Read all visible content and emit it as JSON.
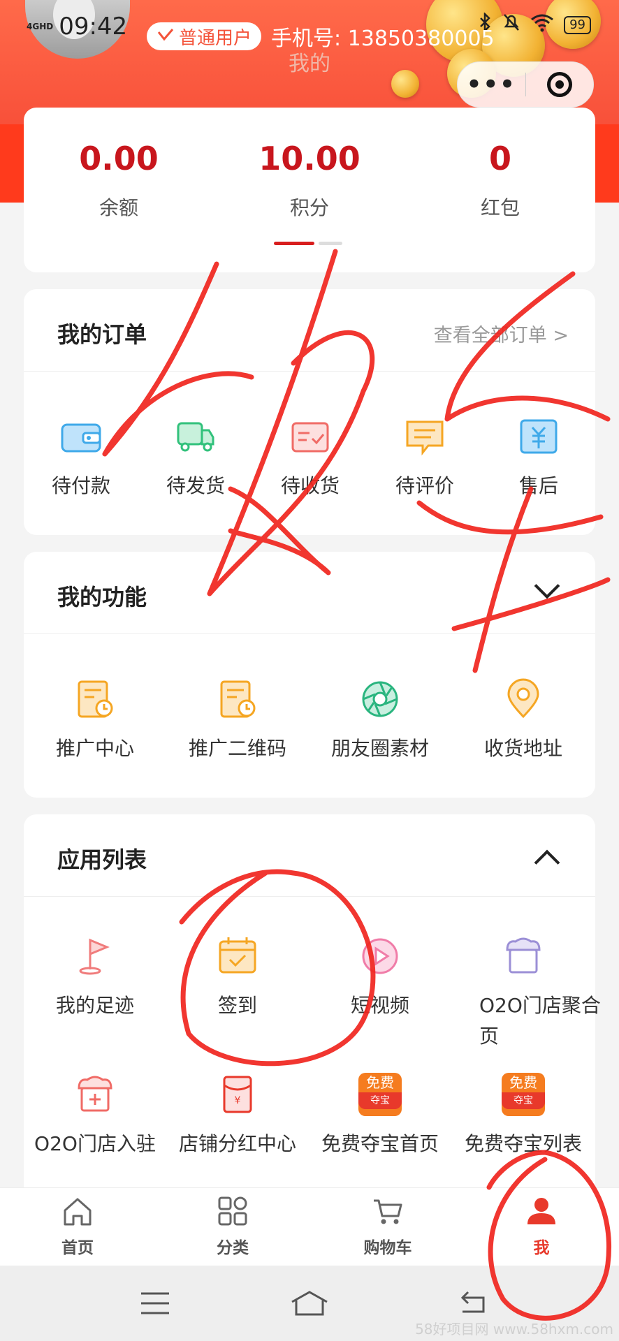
{
  "status_bar": {
    "network": "4GHD",
    "time": "09:42",
    "battery": "99"
  },
  "header": {
    "badge": "普通用户",
    "phone": "手机号: 13850380005",
    "page_title": "我的",
    "capsule_more": "•••"
  },
  "stats": [
    {
      "value": "0.00",
      "label": "余额"
    },
    {
      "value": "10.00",
      "label": "积分"
    },
    {
      "value": "0",
      "label": "红包"
    }
  ],
  "orders": {
    "title": "我的订单",
    "view_all": "查看全部订单 >",
    "items": [
      {
        "label": "待付款",
        "icon": "wallet-icon",
        "color": "#3fa9e9"
      },
      {
        "label": "待发货",
        "icon": "truck-icon",
        "color": "#31c17b"
      },
      {
        "label": "待收货",
        "icon": "receipt-icon",
        "color": "#f06b66"
      },
      {
        "label": "待评价",
        "icon": "comment-icon",
        "color": "#f5a623"
      },
      {
        "label": "售后",
        "icon": "aftersale-icon",
        "color": "#3fa9e9"
      }
    ]
  },
  "functions": {
    "title": "我的功能",
    "items": [
      {
        "label": "推广中心",
        "icon": "promo-center-icon",
        "color": "#f5a623"
      },
      {
        "label": "推广二维码",
        "icon": "qrcode-icon",
        "color": "#f5a623"
      },
      {
        "label": "朋友圈素材",
        "icon": "aperture-icon",
        "color": "#2ab57f"
      },
      {
        "label": "收货地址",
        "icon": "location-icon",
        "color": "#f5a623"
      }
    ]
  },
  "apps": {
    "title": "应用列表",
    "items": [
      {
        "label": "我的足迹",
        "icon": "flag-icon",
        "color": "#f07c7c"
      },
      {
        "label": "签到",
        "icon": "calendar-check-icon",
        "color": "#f5a623"
      },
      {
        "label": "短视频",
        "icon": "play-icon",
        "color": "#f07ca8"
      },
      {
        "label": "O2O门店聚合",
        "label2": "页",
        "icon": "store-icon",
        "color": "#9b8fd6"
      },
      {
        "label": "O2O门店入驻",
        "icon": "store-add-icon",
        "color": "#f06b66"
      },
      {
        "label": "店铺分红中心",
        "icon": "red-envelope-icon",
        "color": "#e8392b"
      },
      {
        "label": "免费夺宝首页",
        "icon": "free-treasure-icon",
        "color": "#f57c1f",
        "badge_top": "免费",
        "badge_bottom": "夺宝"
      },
      {
        "label": "免费夺宝列表",
        "icon": "free-treasure-icon",
        "color": "#f57c1f",
        "badge_top": "免费",
        "badge_bottom": "夺宝"
      }
    ]
  },
  "tabbar": [
    {
      "label": "首页",
      "icon": "home-icon"
    },
    {
      "label": "分类",
      "icon": "category-icon"
    },
    {
      "label": "购物车",
      "icon": "cart-icon"
    },
    {
      "label": "我",
      "icon": "person-icon",
      "active": true
    }
  ],
  "watermark": "58好项目网 www.58hxm.com",
  "colors": {
    "accent": "#e8392b",
    "header": "#f8513a",
    "value_red": "#c8161d"
  }
}
